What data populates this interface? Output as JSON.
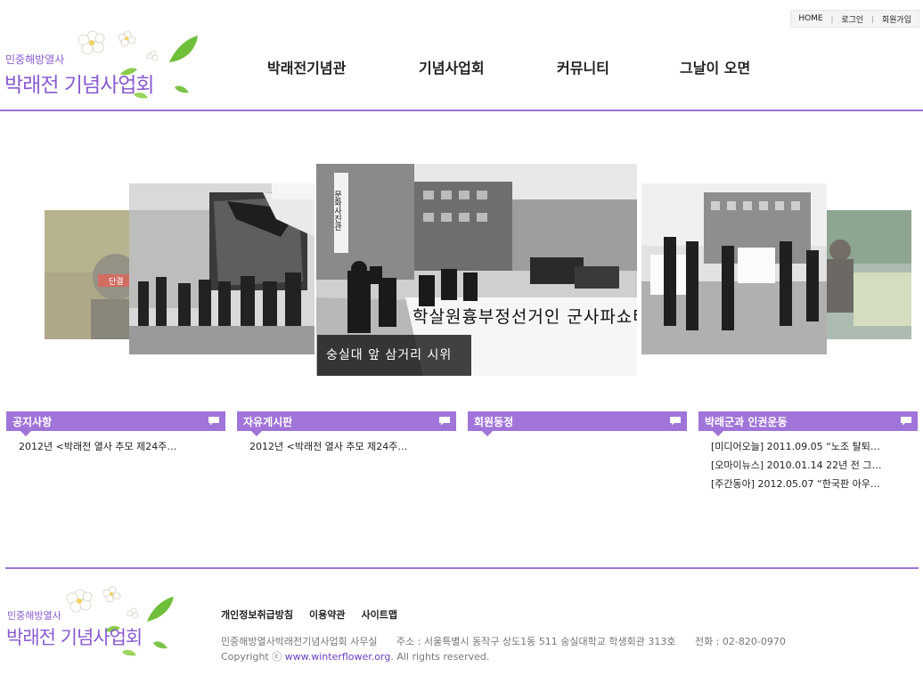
{
  "util_nav": {
    "home": "HOME",
    "login": "로그인",
    "join": "회원가입"
  },
  "logo": {
    "subtitle": "민중해방열사",
    "title": "박래전 기념사업회"
  },
  "gnb": [
    "박래전기념관",
    "기념사업회",
    "커뮤니티",
    "그날이 오면"
  ],
  "slider": {
    "caption": "숭실대 앞 삼거리 시위",
    "left_photo_banner": "단결",
    "center_banner_text": "학살원흉부정선거인 군사파쇼타도하자",
    "center_sign_text": "문화사진관"
  },
  "boards": [
    {
      "title": "공지사항",
      "items": [
        "2012년 <박래전 열사 추모 제24주…"
      ]
    },
    {
      "title": "자유게시판",
      "items": [
        "2012년 <박래전 열사 추모 제24주…"
      ]
    },
    {
      "title": "회원동정",
      "items": []
    },
    {
      "title": "박래군과 인권운동",
      "items": [
        "[미디어오늘] 2011.09.05 “노조 탈퇴…",
        "[오마이뉴스] 2010.01.14 22년 전 그…",
        "[주간동아] 2012.05.07 “한국판 아우…"
      ]
    }
  ],
  "footer": {
    "logo_subtitle": "민중해방열사",
    "logo_title": "박래전 기념사업회",
    "links": [
      "개인정보취급방침",
      "이용약관",
      "사이트맵"
    ],
    "office": "민중해방열사박래전기념사업회 사무실",
    "address": "주소 : 서울특별시 동작구 상도1동 511 숭실대학교 학생회관 313호",
    "phone": "전화 : 02-820-0970",
    "copyright_prefix": "Copyright ⓒ",
    "copyright_url": "www.winterflower.org",
    "copyright_suffix": ". All rights reserved."
  },
  "colors": {
    "accent": "#a074d8",
    "logo_text": "#8a5bd1"
  }
}
